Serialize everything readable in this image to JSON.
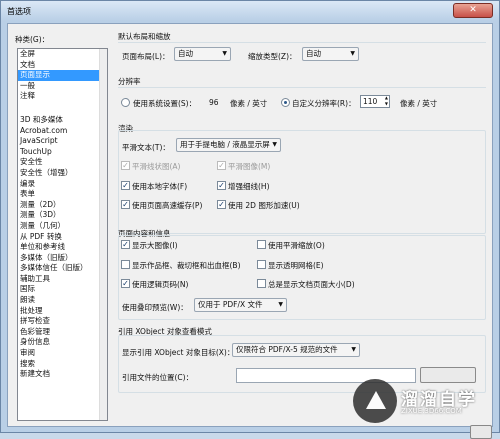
{
  "window": {
    "title": "首选项",
    "close_symbol": "✕"
  },
  "categories": {
    "label": "种类(G)：",
    "top": [
      "全屏",
      "文档",
      "页面显示",
      "一般",
      "注释"
    ],
    "rest": [
      "3D 和多媒体",
      "Acrobat.com",
      "JavaScript",
      "TouchUp",
      "安全性",
      "安全性（增强）",
      "编录",
      "表单",
      "测量（2D）",
      "测量（3D）",
      "测量（几何）",
      "从 PDF 转换",
      "单位和参考线",
      "多媒体（旧版）",
      "多媒体信任（旧版）",
      "辅助工具",
      "国际",
      "朗读",
      "批处理",
      "拼写检查",
      "色彩管理",
      "身份信息",
      "审阅",
      "搜索",
      "新建文档"
    ],
    "selected": "页面显示"
  },
  "layout_zoom": {
    "heading": "默认布局和缩放",
    "page_layout_label": "页面布局(L)：",
    "page_layout_value": "自动",
    "zoom_label": "缩放类型(Z)：",
    "zoom_value": "自动"
  },
  "resolution": {
    "heading": "分辨率",
    "system_label": "使用系统设置(S)：",
    "system_value": "96",
    "system_unit": "像素 / 英寸",
    "custom_label": "自定义分辨率(R)：",
    "custom_value": "110",
    "custom_unit": "像素 / 英寸"
  },
  "rendering": {
    "heading": "渲染",
    "smooth_text_label": "平滑文本(T)：",
    "smooth_text_value": "用于手提电脑 / 液晶显示屏",
    "smooth_line_art": "平滑线状图(A)",
    "smooth_images": "平滑图像(M)",
    "local_fonts": "使用本地字体(F)",
    "enhance_thin_lines": "增强细线(H)",
    "page_cache": "使用页面高速缓存(P)",
    "use_2d_gpu": "使用 2D 图形加速(U)"
  },
  "page_content": {
    "heading": "页面内容和信息",
    "show_large_images": "显示大图像(I)",
    "smooth_zoom": "使用平滑缩放(O)",
    "show_art_boxes": "显示作品框、裁切框和出血框(B)",
    "show_transparency_grid": "显示透明网格(E)",
    "logical_page_numbers": "使用逻辑页码(N)",
    "always_show_doc_size": "总是显示文档页面大小(D)",
    "overprint_label": "使用叠印预览(W)：",
    "overprint_value": "仅用于 PDF/X 文件"
  },
  "xobject": {
    "heading": "引用 XObject 对象查看模式",
    "show_targets_label": "显示引用 XObject 对象目标(X)：",
    "show_targets_value": "仅限符合 PDF/X-5 规范的文件",
    "file_location_label": "引用文件的位置(C)："
  },
  "watermark": {
    "title": "溜溜自学",
    "url": "ZIXUE.3D66.COM"
  }
}
